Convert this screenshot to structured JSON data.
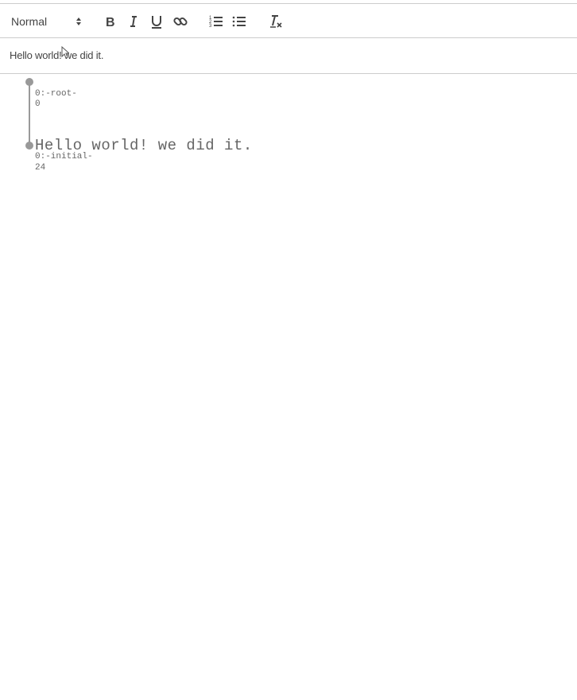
{
  "toolbar": {
    "header_select": {
      "value": "Normal"
    },
    "buttons": [
      {
        "name": "bold",
        "icon": "bold-icon"
      },
      {
        "name": "italic",
        "icon": "italic-icon"
      },
      {
        "name": "underline",
        "icon": "underline-icon"
      },
      {
        "name": "link",
        "icon": "link-icon"
      },
      {
        "name": "ordered-list",
        "icon": "ordered-list-icon"
      },
      {
        "name": "bullet-list",
        "icon": "bullet-list-icon"
      },
      {
        "name": "clean",
        "icon": "clear-format-icon"
      }
    ]
  },
  "editor": {
    "text": "Hello world! we did it."
  },
  "tree": {
    "nodes": [
      {
        "id": "0:-root-",
        "offset": "0",
        "text": ""
      },
      {
        "id": "0:-initial-",
        "offset": "24",
        "text": "Hello world! we did it."
      }
    ]
  },
  "colors": {
    "toolbar_text": "#444444",
    "border": "#cccccc",
    "tree_line": "#999999"
  }
}
